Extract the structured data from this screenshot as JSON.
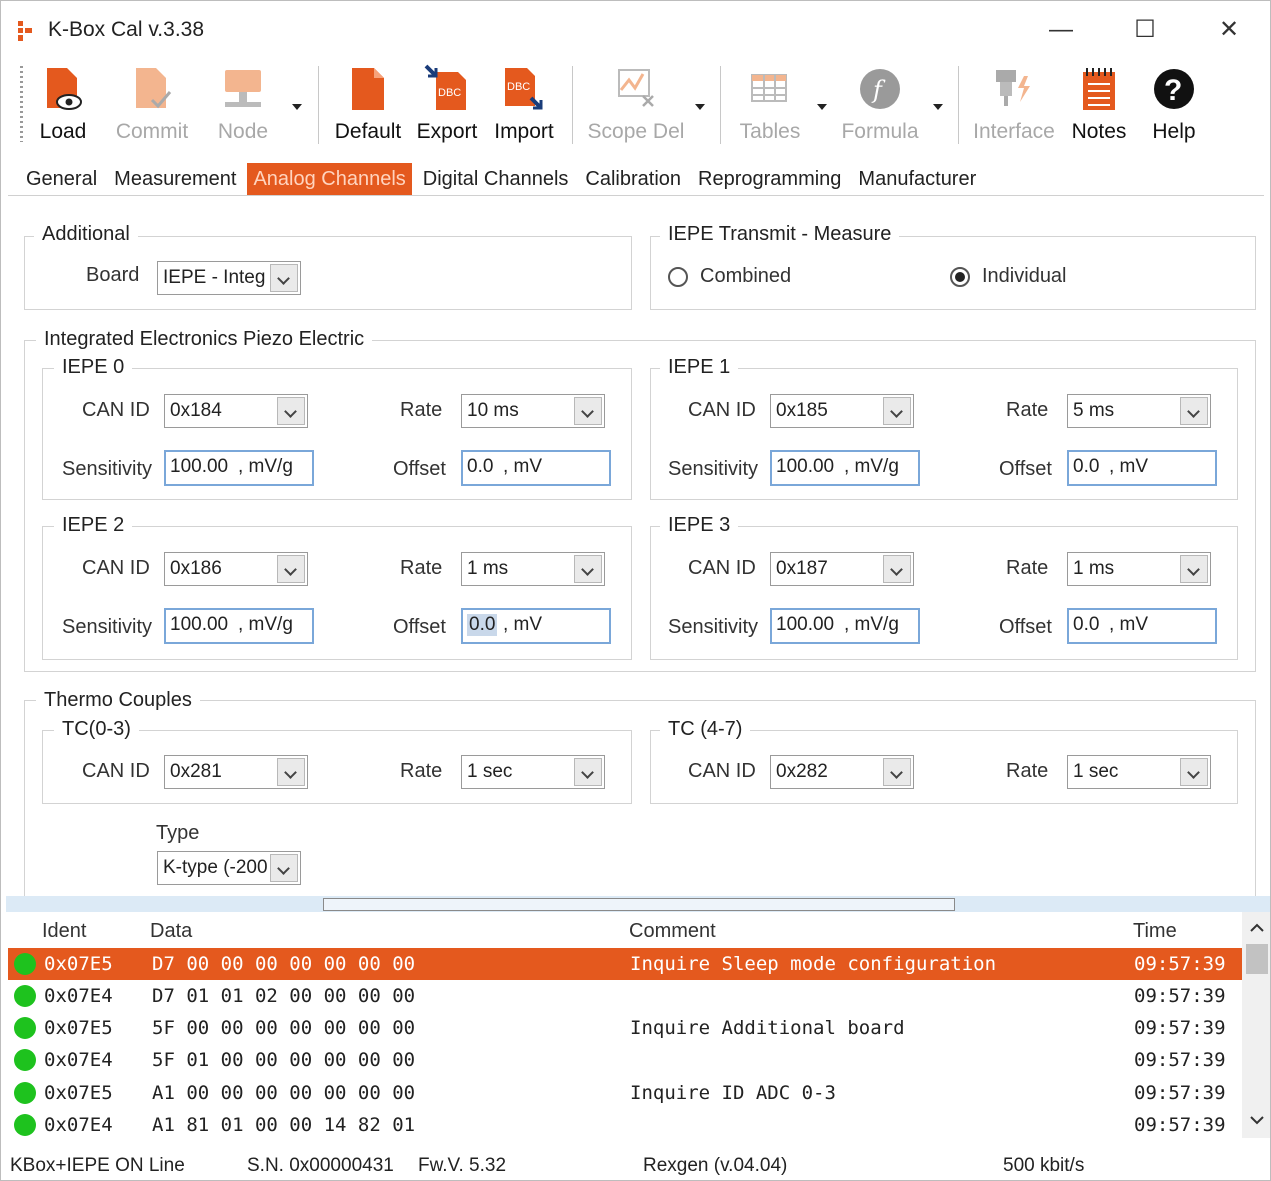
{
  "window": {
    "title": "K-Box Cal v.3.38",
    "minimize": "—",
    "maximize": "☐",
    "close": "✕"
  },
  "toolbar": {
    "load": "Load",
    "commit": "Commit",
    "node": "Node",
    "default": "Default",
    "export": "Export",
    "import": "Import",
    "scope_del": "Scope Del",
    "tables": "Tables",
    "formula": "Formula",
    "interface": "Interface",
    "notes": "Notes",
    "help": "Help",
    "dbc": "DBC"
  },
  "tabs": [
    "General",
    "Measurement",
    "Analog Channels",
    "Digital Channels",
    "Calibration",
    "Reprogramming",
    "Manufacturer"
  ],
  "additional": {
    "title": "Additional",
    "board_label": "Board",
    "board_value": "IEPE - Integ"
  },
  "iepe_transmit": {
    "title": "IEPE Transmit - Measure",
    "combined": "Combined",
    "individual": "Individual",
    "selected": "Individual"
  },
  "iepe_group": {
    "title": "Integrated Electronics Piezo Electric",
    "labels": {
      "can_id": "CAN ID",
      "rate": "Rate",
      "sensitivity": "Sensitivity",
      "offset": "Offset",
      "sens_unit": ", mV/g",
      "offset_unit": ", mV"
    },
    "channels": [
      {
        "title": "IEPE 0",
        "can_id": "0x184",
        "rate": "10 ms",
        "sensitivity": "100.00",
        "offset": "0.0"
      },
      {
        "title": "IEPE 1",
        "can_id": "0x185",
        "rate": "5 ms",
        "sensitivity": "100.00",
        "offset": "0.0"
      },
      {
        "title": "IEPE 2",
        "can_id": "0x186",
        "rate": "1 ms",
        "sensitivity": "100.00",
        "offset": "0.0"
      },
      {
        "title": "IEPE 3",
        "can_id": "0x187",
        "rate": "1 ms",
        "sensitivity": "100.00",
        "offset": "0.0"
      }
    ]
  },
  "thermo": {
    "title": "Thermo Couples",
    "tc": [
      {
        "title": "TC(0-3)",
        "can_id": "0x281",
        "rate": "1 sec"
      },
      {
        "title": "TC (4-7)",
        "can_id": "0x282",
        "rate": "1 sec"
      }
    ],
    "type_label": "Type",
    "type_value": "K-type (-200"
  },
  "log": {
    "headers": {
      "ident": "Ident",
      "data": "Data",
      "comment": "Comment",
      "time": "Time"
    },
    "rows": [
      {
        "ident": "0x07E5",
        "data": "D7 00 00 00 00 00 00 00",
        "comment": "Inquire Sleep mode configuration",
        "time": "09:57:39"
      },
      {
        "ident": "0x07E4",
        "data": "D7 01 01 02 00 00 00 00",
        "comment": "",
        "time": "09:57:39"
      },
      {
        "ident": "0x07E5",
        "data": "5F 00 00 00 00 00 00 00",
        "comment": "Inquire Additional board",
        "time": "09:57:39"
      },
      {
        "ident": "0x07E4",
        "data": "5F 01 00 00 00 00 00 00",
        "comment": "",
        "time": "09:57:39"
      },
      {
        "ident": "0x07E5",
        "data": "A1 00 00 00 00 00 00 00",
        "comment": "Inquire ID ADC 0-3",
        "time": "09:57:39"
      },
      {
        "ident": "0x07E4",
        "data": "A1 81 01 00 00 14 82 01",
        "comment": "",
        "time": "09:57:39"
      }
    ]
  },
  "statusbar": {
    "device": "KBox+IEPE  ON Line",
    "serial": "S.N. 0x00000431",
    "firmware": "Fw.V. 5.32",
    "rexgen": "Rexgen (v.04.04)",
    "baud": "500 kbit/s"
  },
  "colors": {
    "accent": "#e4591e",
    "online": "#1ec21e",
    "focus_border": "#7aa7d9"
  }
}
